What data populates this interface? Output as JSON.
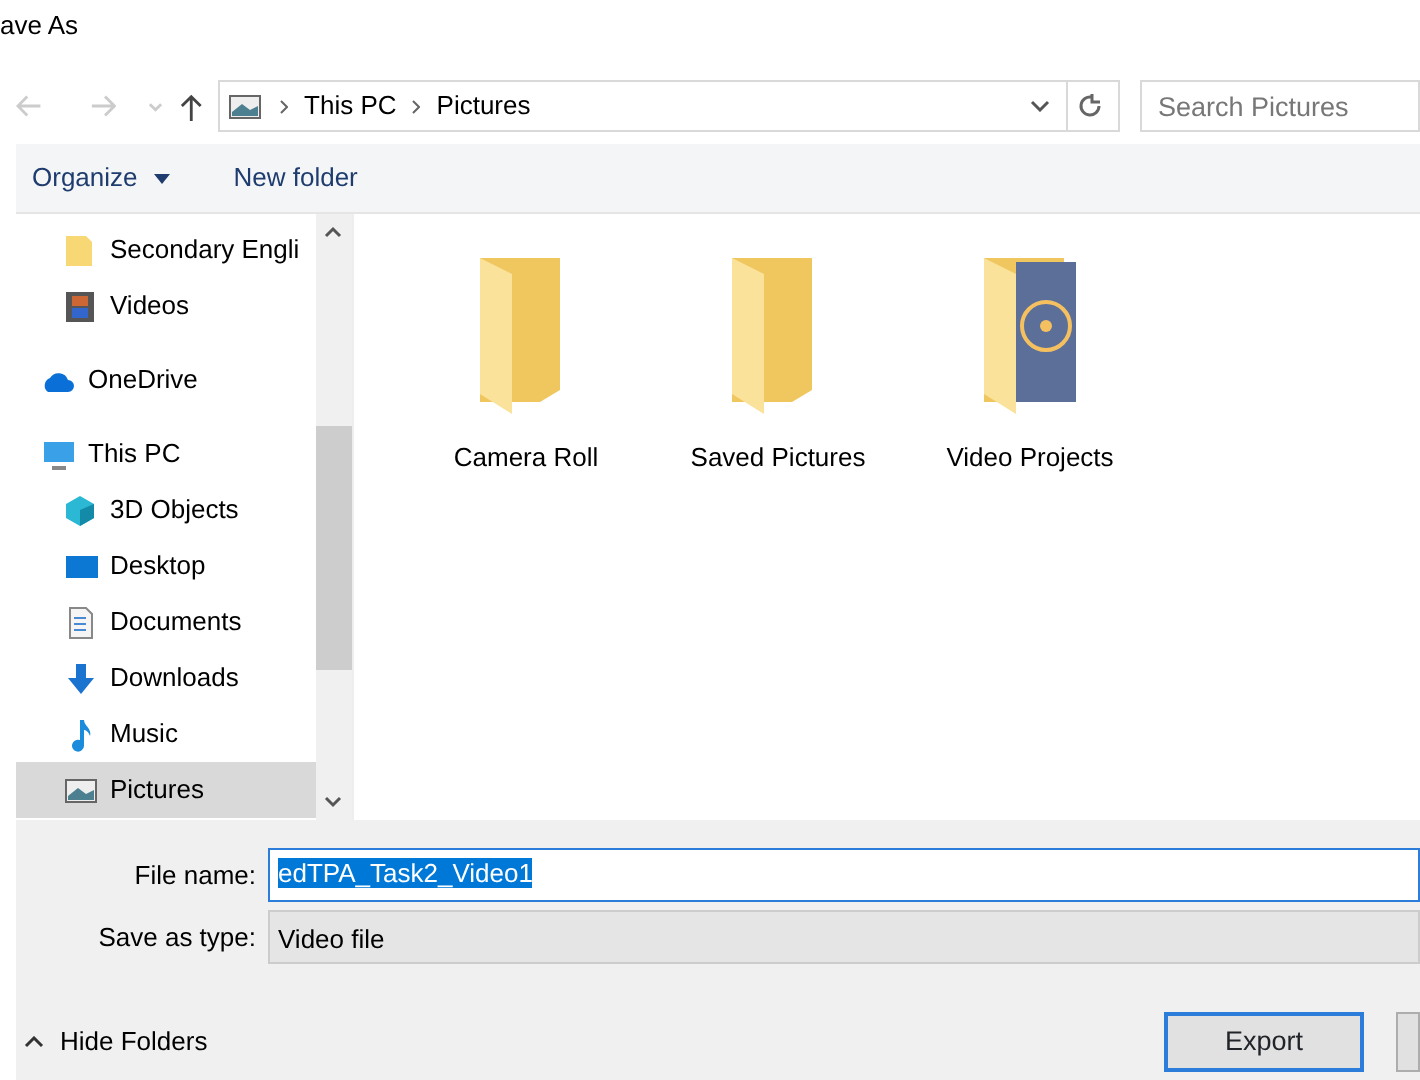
{
  "window": {
    "title": "ave As"
  },
  "nav": {
    "path": [
      "This PC",
      "Pictures"
    ],
    "search": {
      "placeholder": "Search Pictures"
    }
  },
  "toolbar": {
    "organize": "Organize",
    "new_folder": "New folder"
  },
  "sidebar": {
    "scrolled_items": [
      {
        "label": "Secondary Engli",
        "kind": "folder",
        "selected": false
      },
      {
        "label": "Videos",
        "kind": "video",
        "selected": false
      }
    ],
    "items": [
      {
        "label": "OneDrive",
        "kind": "cloud",
        "selected": false
      },
      {
        "label": "This PC",
        "kind": "pc",
        "selected": false,
        "children": [
          {
            "label": "3D Objects",
            "kind": "cube",
            "selected": false
          },
          {
            "label": "Desktop",
            "kind": "desktop",
            "selected": false
          },
          {
            "label": "Documents",
            "kind": "document",
            "selected": false
          },
          {
            "label": "Downloads",
            "kind": "download",
            "selected": false
          },
          {
            "label": "Music",
            "kind": "music",
            "selected": false
          },
          {
            "label": "Pictures",
            "kind": "pictures",
            "selected": true
          }
        ]
      }
    ]
  },
  "folders": [
    {
      "name": "Camera Roll",
      "kind": "folder"
    },
    {
      "name": "Saved Pictures",
      "kind": "folder"
    },
    {
      "name": "Video Projects",
      "kind": "video-folder"
    }
  ],
  "form": {
    "file_name_label": "File name:",
    "file_name": "edTPA_Task2_Video1",
    "type_label": "Save as type:",
    "type": "Video file"
  },
  "footer": {
    "hide_folders": "Hide Folders",
    "export": "Export"
  }
}
